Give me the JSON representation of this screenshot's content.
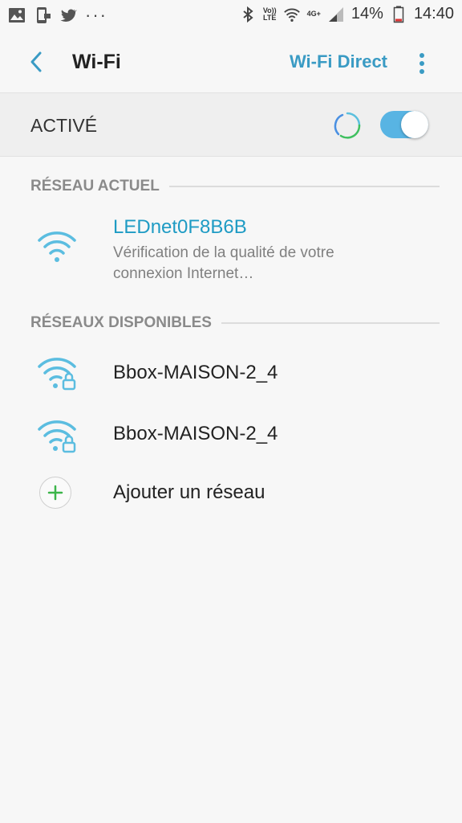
{
  "status_bar": {
    "left_icons": [
      "gallery-icon",
      "screenshot-icon",
      "twitter-icon",
      "more-notifications-icon"
    ],
    "more_notifications": "···",
    "volte_label": "Vo)) LTE",
    "network_label": "4G+",
    "battery_percent": "14%",
    "time": "14:40"
  },
  "app_bar": {
    "title": "Wi-Fi",
    "action_label": "Wi-Fi Direct"
  },
  "wifi_toggle": {
    "label": "ACTIVÉ",
    "enabled": true,
    "accent_color": "#58b4e3"
  },
  "current_network": {
    "section_label": "RÉSEAU ACTUEL",
    "name": "LEDnet0F8B6B",
    "status_line1": "Vérification de la qualité de votre",
    "status_line2": "connexion Internet…",
    "name_color": "#1e9bc4"
  },
  "available_networks": {
    "section_label": "RÉSEAUX DISPONIBLES",
    "items": [
      {
        "name": "Bbox-MAISON-2_4",
        "secured": true
      },
      {
        "name": "Bbox-MAISON-2_4",
        "secured": true
      }
    ],
    "add_label": "Ajouter un réseau"
  }
}
